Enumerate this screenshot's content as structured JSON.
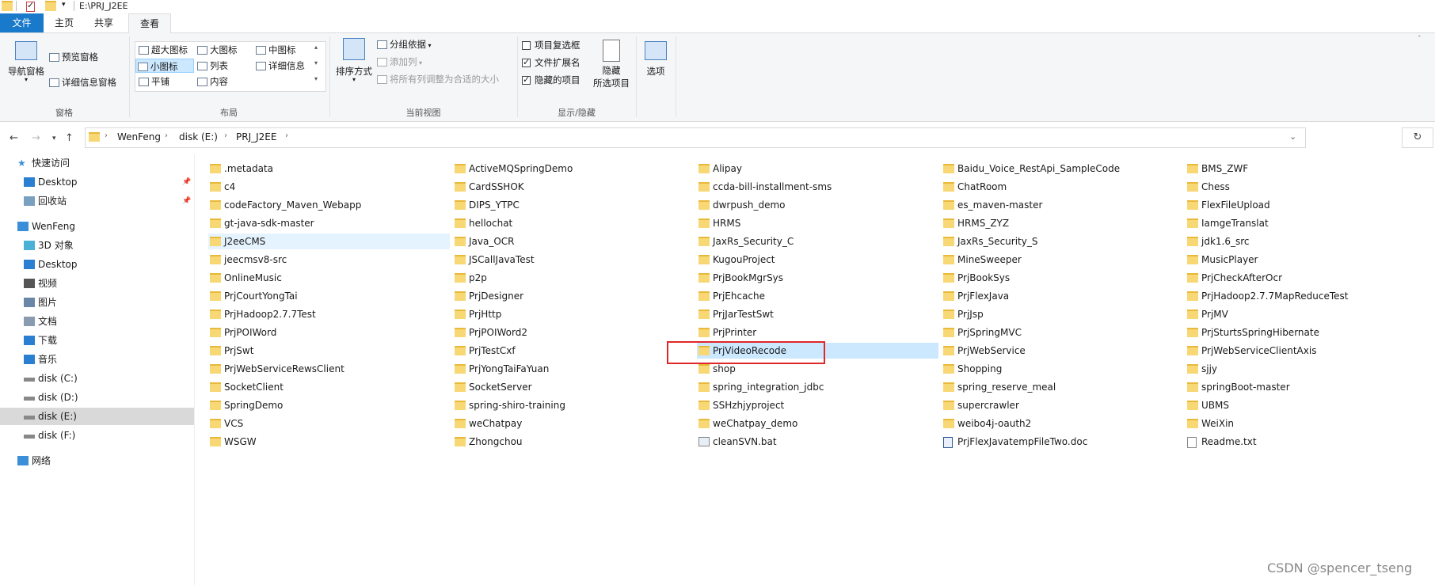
{
  "window": {
    "title": "E:\\PRJ_J2EE"
  },
  "ribbon": {
    "tabs": [
      "文件",
      "主页",
      "共享",
      "查看"
    ],
    "panes": {
      "nav_pane": "导航窗格",
      "preview_pane": "预览窗格",
      "details_pane": "详细信息窗格",
      "group": "窗格"
    },
    "layout": {
      "items": [
        "超大图标",
        "大图标",
        "中图标",
        "小图标",
        "列表",
        "详细信息",
        "平铺",
        "内容"
      ],
      "selected": "小图标",
      "group": "布局"
    },
    "current_view": {
      "sort": "排序方式",
      "group_by": "分组依据",
      "add_column": "添加列",
      "fit_columns": "将所有列调整为合适的大小",
      "group": "当前视图"
    },
    "show_hide": {
      "item_checkboxes": "项目复选框",
      "file_extensions": "文件扩展名",
      "hidden_items": "隐藏的项目",
      "hide_selected_line1": "隐藏",
      "hide_selected_line2": "所选项目",
      "options": "选项",
      "group": "显示/隐藏",
      "checked": {
        "item_checkboxes": false,
        "file_extensions": true,
        "hidden_items": true
      }
    }
  },
  "address": {
    "crumbs": [
      "WenFeng",
      "disk (E:)",
      "PRJ_J2EE"
    ]
  },
  "sidebar": {
    "items": [
      {
        "label": "快速访问",
        "icon": "star-icon"
      },
      {
        "label": "Desktop",
        "icon": "desktop-icon",
        "pinned": true
      },
      {
        "label": "回收站",
        "icon": "recycle-bin-icon",
        "pinned": true
      },
      {
        "label": "WenFeng",
        "icon": "computer-icon"
      },
      {
        "label": "3D 对象",
        "icon": "cube-icon"
      },
      {
        "label": "Desktop",
        "icon": "desktop-icon"
      },
      {
        "label": "视频",
        "icon": "video-icon"
      },
      {
        "label": "图片",
        "icon": "picture-icon"
      },
      {
        "label": "文档",
        "icon": "document-icon"
      },
      {
        "label": "下载",
        "icon": "download-icon"
      },
      {
        "label": "音乐",
        "icon": "music-icon"
      },
      {
        "label": "disk (C:)",
        "icon": "drive-icon"
      },
      {
        "label": "disk (D:)",
        "icon": "drive-icon"
      },
      {
        "label": "disk (E:)",
        "icon": "drive-icon",
        "selected": true
      },
      {
        "label": "disk (F:)",
        "icon": "drive-icon"
      },
      {
        "label": "网络",
        "icon": "network-icon"
      }
    ]
  },
  "files": {
    "columns": [
      [
        ".metadata",
        "c4",
        "codeFactory_Maven_Webapp",
        "gt-java-sdk-master",
        "J2eeCMS",
        "jeecmsv8-src",
        "OnlineMusic",
        "PrjCourtYongTai",
        "PrjHadoop2.7.7Test",
        "PrjPOIWord",
        "PrjSwt",
        "PrjWebServiceRewsClient",
        "SocketClient",
        "SpringDemo",
        "VCS",
        "WSGW"
      ],
      [
        "ActiveMQSpringDemo",
        "CardSSHOK",
        "DIPS_YTPC",
        "hellochat",
        "Java_OCR",
        "JSCallJavaTest",
        "p2p",
        "PrjDesigner",
        "PrjHttp",
        "PrjPOIWord2",
        "PrjTestCxf",
        "PrjYongTaiFaYuan",
        "SocketServer",
        "spring-shiro-training",
        "weChatpay",
        "Zhongchou"
      ],
      [
        "Alipay",
        "ccda-bill-installment-sms",
        "dwrpush_demo",
        "HRMS",
        "JaxRs_Security_C",
        "KugouProject",
        "PrjBookMgrSys",
        "PrjEhcache",
        "PrjJarTestSwt",
        "PrjPrinter",
        "PrjVideoRecode",
        "shop",
        "spring_integration_jdbc",
        "SSHzhjyproject",
        "weChatpay_demo",
        "cleanSVN.bat"
      ],
      [
        "Baidu_Voice_RestApi_SampleCode",
        "ChatRoom",
        "es_maven-master",
        "HRMS_ZYZ",
        "JaxRs_Security_S",
        "MineSweeper",
        "PrjBookSys",
        "PrjFlexJava",
        "PrjJsp",
        "PrjSpringMVC",
        "PrjWebService",
        "Shopping",
        "spring_reserve_meal",
        "supercrawler",
        "weibo4j-oauth2",
        "PrjFlexJavatempFileTwo.doc"
      ],
      [
        "BMS_ZWF",
        "Chess",
        "FlexFileUpload",
        "IamgeTranslat",
        "jdk1.6_src",
        "MusicPlayer",
        "PrjCheckAfterOcr",
        "PrjHadoop2.7.7MapReduceTest",
        "PrjMV",
        "PrjSturtsSpringHibernate",
        "PrjWebServiceClientAxis",
        "sjjy",
        "springBoot-master",
        "UBMS",
        "WeiXin",
        "Readme.txt"
      ]
    ],
    "hovered": "J2eeCMS",
    "selected": "PrjVideoRecode"
  },
  "watermark": "CSDN @spencer_tseng"
}
